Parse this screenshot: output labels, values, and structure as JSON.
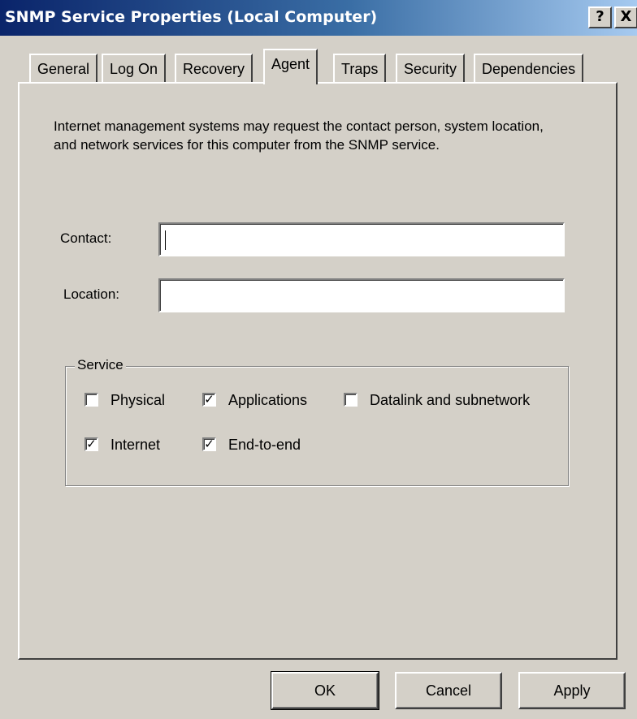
{
  "window": {
    "title": "SNMP Service Properties (Local Computer)",
    "help_label": "?",
    "close_label": "X"
  },
  "tabs": [
    {
      "label": "General",
      "active": false
    },
    {
      "label": "Log On",
      "active": false
    },
    {
      "label": "Recovery",
      "active": false
    },
    {
      "label": "Agent",
      "active": true
    },
    {
      "label": "Traps",
      "active": false
    },
    {
      "label": "Security",
      "active": false
    },
    {
      "label": "Dependencies",
      "active": false
    }
  ],
  "agent": {
    "description": "Internet management systems may request the contact person, system location, and network services for this computer from the SNMP service.",
    "contact_label": "Contact:",
    "contact_value": "",
    "location_label": "Location:",
    "location_value": "",
    "service_group_label": "Service",
    "services": [
      {
        "label": "Physical",
        "checked": false
      },
      {
        "label": "Applications",
        "checked": true
      },
      {
        "label": "Datalink and subnetwork",
        "checked": false
      },
      {
        "label": "Internet",
        "checked": true
      },
      {
        "label": "End-to-end",
        "checked": true
      }
    ]
  },
  "buttons": {
    "ok": "OK",
    "cancel": "Cancel",
    "apply": "Apply"
  }
}
